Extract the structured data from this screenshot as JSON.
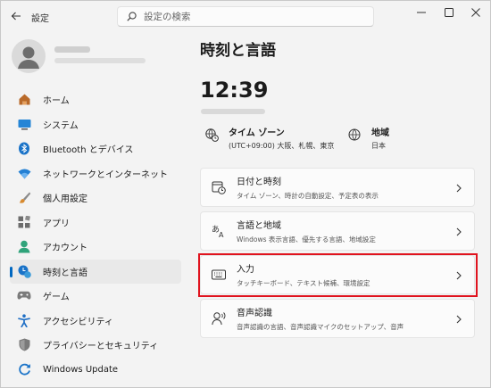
{
  "titlebar": {
    "app_title": "設定",
    "search_placeholder": "設定の検索"
  },
  "sidebar": {
    "items": [
      {
        "label": "ホーム",
        "icon": "home-icon"
      },
      {
        "label": "システム",
        "icon": "system-icon"
      },
      {
        "label": "Bluetooth とデバイス",
        "icon": "bluetooth-icon"
      },
      {
        "label": "ネットワークとインターネット",
        "icon": "wifi-icon"
      },
      {
        "label": "個人用設定",
        "icon": "brush-icon"
      },
      {
        "label": "アプリ",
        "icon": "apps-icon"
      },
      {
        "label": "アカウント",
        "icon": "account-icon"
      },
      {
        "label": "時刻と言語",
        "icon": "time-language-icon",
        "active": true
      },
      {
        "label": "ゲーム",
        "icon": "gamepad-icon"
      },
      {
        "label": "アクセシビリティ",
        "icon": "accessibility-icon"
      },
      {
        "label": "プライバシーとセキュリティ",
        "icon": "shield-icon"
      },
      {
        "label": "Windows Update",
        "icon": "windows-update-icon"
      }
    ]
  },
  "main": {
    "title": "時刻と言語",
    "clock": "12:39",
    "timezone": {
      "title": "タイム ゾーン",
      "value": "(UTC+09:00) 大阪、札幌、東京"
    },
    "region": {
      "title": "地域",
      "value": "日本"
    },
    "cards": [
      {
        "title": "日付と時刻",
        "subtitle": "タイム ゾーン、時計の自動設定、予定表の表示",
        "icon": "calendar-clock-icon"
      },
      {
        "title": "言語と地域",
        "subtitle": "Windows 表示言語、優先する言語、地域設定",
        "icon": "language-icon"
      },
      {
        "title": "入力",
        "subtitle": "タッチキーボード、テキスト候補、環境設定",
        "icon": "keyboard-icon",
        "highlighted": true
      },
      {
        "title": "音声認識",
        "subtitle": "音声認識の言語、音声認識マイクのセットアップ、音声",
        "icon": "speech-icon"
      }
    ]
  },
  "colors": {
    "accent": "#0067c0",
    "highlight": "#e0131e"
  }
}
